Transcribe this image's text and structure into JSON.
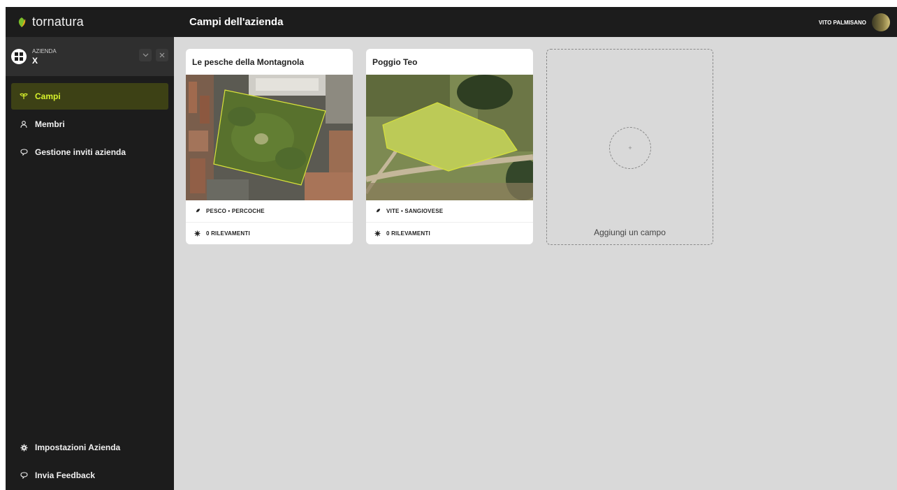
{
  "app": {
    "brand": "tornatura",
    "page_title": "Campi dell'azienda"
  },
  "user": {
    "name": "VITO PALMISANO"
  },
  "org": {
    "label": "AZIENDA",
    "name": "X"
  },
  "nav": {
    "items": [
      {
        "label": "Campi",
        "icon": "sprout-icon",
        "active": true
      },
      {
        "label": "Membri",
        "icon": "user-icon",
        "active": false
      },
      {
        "label": "Gestione inviti azienda",
        "icon": "chat-bubble-icon",
        "active": false
      }
    ],
    "bottom": [
      {
        "label": "Impostazioni Azienda",
        "icon": "gear-icon"
      },
      {
        "label": "Invia Feedback",
        "icon": "chat-bubble-icon"
      }
    ]
  },
  "fields": [
    {
      "name": "Le pesche della Montagnola",
      "crop": "PESCO • PERCOCHE",
      "surveys": "0 RILEVAMENTI"
    },
    {
      "name": "Poggio Teo",
      "crop": "VITE • SANGIOVESE",
      "surveys": "0 RILEVAMENTI"
    }
  ],
  "add_field": {
    "label": "Aggiungi un campo",
    "icon": "+"
  },
  "colors": {
    "accent": "#d7f22c",
    "sidebar": "#1c1c1c",
    "active_bg": "#3d4115",
    "content_bg": "#d9d9d9",
    "polygon": "#d8e23a"
  }
}
